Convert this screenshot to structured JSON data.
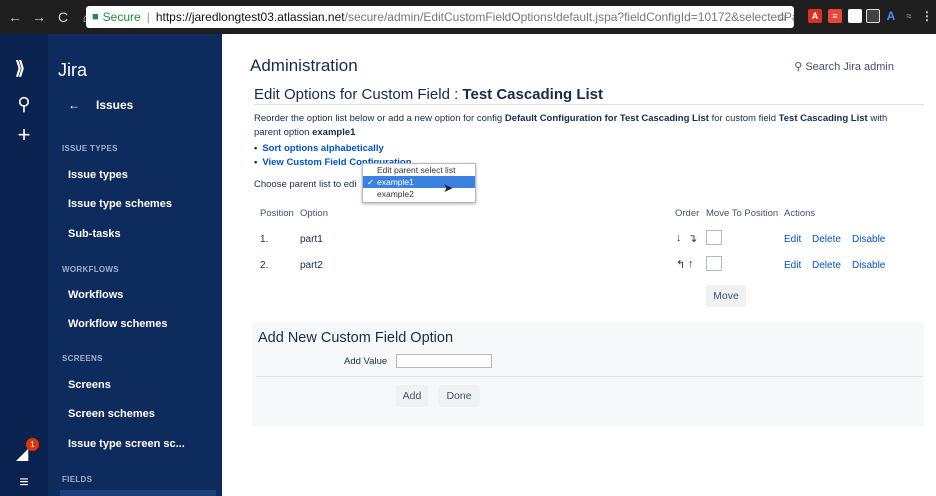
{
  "browser": {
    "url_host": "https://jaredlongtest03.atlassian.net",
    "url_path": "/secure/admin/EditCustomFieldOptions!default.jspa?fieldConfigId=10172&selectedParentOp...",
    "secure_label": "Secure"
  },
  "sidebar": {
    "product": "Jira",
    "back_label": "Issues",
    "sections": [
      {
        "title": "ISSUE TYPES",
        "items": [
          "Issue types",
          "Issue type schemes",
          "Sub-tasks"
        ]
      },
      {
        "title": "WORKFLOWS",
        "items": [
          "Workflows",
          "Workflow schemes"
        ]
      },
      {
        "title": "SCREENS",
        "items": [
          "Screens",
          "Screen schemes",
          "Issue type screen sc..."
        ]
      },
      {
        "title": "FIELDS",
        "items": []
      }
    ],
    "notification_count": "1"
  },
  "header": {
    "title": "Administration",
    "search_label": "Search Jira admin"
  },
  "page": {
    "title_prefix": "Edit Options for Custom Field : ",
    "title_field": "Test Cascading List",
    "desc_1": "Reorder the option list below or add a new option for config ",
    "desc_config": "Default Configuration for Test Cascading List",
    "desc_2": " for custom field ",
    "desc_field": "Test Cascading List",
    "desc_3": " with parent option ",
    "desc_parent": "example1",
    "links": [
      "Sort options alphabetically",
      "View Custom Field Configuration"
    ],
    "choose_label": "Choose parent list to edi"
  },
  "dropdown": {
    "header": "Edit parent select list",
    "options": [
      "example1",
      "example2"
    ],
    "selected": "example1"
  },
  "table": {
    "headers": {
      "position": "Position",
      "option": "Option",
      "order": "Order",
      "move_to": "Move To Position",
      "actions": "Actions"
    },
    "rows": [
      {
        "position": "1.",
        "option": "part1",
        "actions": [
          "Edit",
          "Delete",
          "Disable"
        ]
      },
      {
        "position": "2.",
        "option": "part2",
        "actions": [
          "Edit",
          "Delete",
          "Disable"
        ]
      }
    ],
    "move_button": "Move"
  },
  "add_form": {
    "title": "Add New Custom Field Option",
    "value_label": "Add Value",
    "value": "",
    "add_button": "Add",
    "done_button": "Done"
  }
}
